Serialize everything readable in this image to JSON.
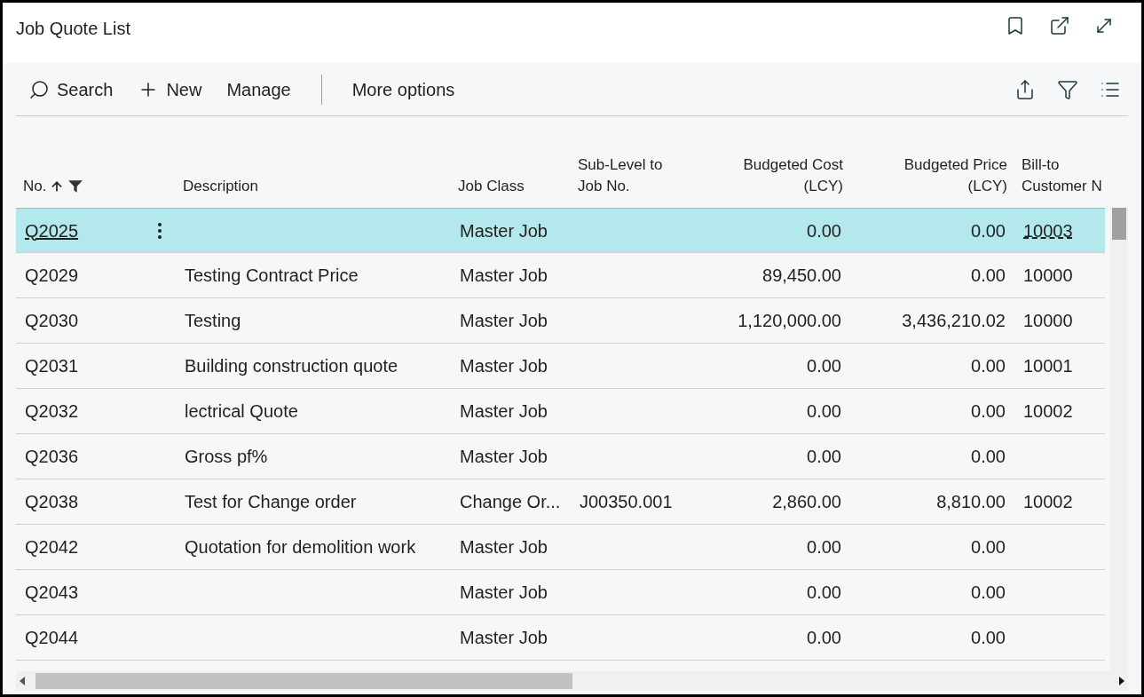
{
  "window": {
    "title": "Job Quote List"
  },
  "toolbar": {
    "actions": [
      {
        "kind": "search",
        "label": "Search"
      },
      {
        "kind": "new",
        "label": "New"
      },
      {
        "kind": "plain",
        "label": "Manage"
      },
      {
        "kind": "divider",
        "label": "More options"
      }
    ]
  },
  "table": {
    "columns": [
      {
        "label": "No.",
        "kind": "text",
        "sorted": true,
        "filtered": true
      },
      {
        "label": "Description",
        "kind": "text"
      },
      {
        "label": "Job Class",
        "kind": "text"
      },
      {
        "label": "Sub-Level to Job No.",
        "kind": "text"
      },
      {
        "label": "Budgeted Cost (LCY)",
        "kind": "amount"
      },
      {
        "label": "Budgeted Price (LCY)",
        "kind": "amount"
      },
      {
        "label": "Bill-to Customer N",
        "kind": "text"
      }
    ],
    "rows": [
      {
        "selected": true,
        "cells": [
          "Q2025",
          "",
          "Master Job",
          "",
          "0.00",
          "0.00",
          "10003"
        ]
      },
      {
        "selected": false,
        "cells": [
          "Q2029",
          "Testing Contract Price",
          "Master Job",
          "",
          "89,450.00",
          "0.00",
          "10000"
        ]
      },
      {
        "selected": false,
        "cells": [
          "Q2030",
          "Testing",
          "Master Job",
          "",
          "1,120,000.00",
          "3,436,210.02",
          "10000"
        ]
      },
      {
        "selected": false,
        "cells": [
          "Q2031",
          "Building construction quote",
          "Master Job",
          "",
          "0.00",
          "0.00",
          "10001"
        ]
      },
      {
        "selected": false,
        "cells": [
          "Q2032",
          "lectrical Quote",
          "Master Job",
          "",
          "0.00",
          "0.00",
          "10002"
        ]
      },
      {
        "selected": false,
        "cells": [
          "Q2036",
          "Gross pf%",
          "Master Job",
          "",
          "0.00",
          "0.00",
          ""
        ]
      },
      {
        "selected": false,
        "cells": [
          "Q2038",
          "Test for Change order",
          "Change Or...",
          "J00350.001",
          "2,860.00",
          "8,810.00",
          "10002"
        ]
      },
      {
        "selected": false,
        "cells": [
          "Q2042",
          "Quotation for demolition work",
          "Master Job",
          "",
          "0.00",
          "0.00",
          ""
        ]
      },
      {
        "selected": false,
        "cells": [
          "Q2043",
          "",
          "Master Job",
          "",
          "0.00",
          "0.00",
          ""
        ]
      },
      {
        "selected": false,
        "cells": [
          "Q2044",
          "",
          "Master Job",
          "",
          "0.00",
          "0.00",
          ""
        ]
      }
    ]
  }
}
